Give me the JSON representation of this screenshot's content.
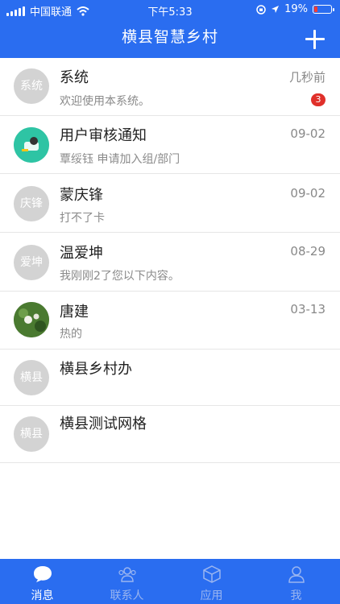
{
  "status_bar": {
    "carrier": "中国联通",
    "time": "下午5:33",
    "battery": "19%"
  },
  "header": {
    "title": "横县智慧乡村"
  },
  "messages": [
    {
      "avatar_text": "系统",
      "title": "系统",
      "time": "几秒前",
      "subtitle": "欢迎使用本系统。",
      "badge": "3"
    },
    {
      "avatar_text": "",
      "title": "用户审核通知",
      "time": "09-02",
      "subtitle": "覃绥钰 申请加入组/部门"
    },
    {
      "avatar_text": "庆锋",
      "title": "蒙庆锋",
      "time": "09-02",
      "subtitle": "打不了卡"
    },
    {
      "avatar_text": "爱坤",
      "title": "温爱坤",
      "time": "08-29",
      "subtitle": "我刚刚2了您以下内容。"
    },
    {
      "avatar_text": "",
      "title": "唐建",
      "time": "03-13",
      "subtitle": "热的"
    },
    {
      "avatar_text": "横县",
      "title": "横县乡村办"
    },
    {
      "avatar_text": "横县",
      "title": "横县测试网格"
    }
  ],
  "tabbar": {
    "tabs": [
      {
        "label": "消息",
        "icon": "chat-bubble-icon",
        "active": true
      },
      {
        "label": "联系人",
        "icon": "contacts-icon",
        "active": false
      },
      {
        "label": "应用",
        "icon": "cube-icon",
        "active": false
      },
      {
        "label": "我",
        "icon": "person-icon",
        "active": false
      }
    ]
  },
  "colors": {
    "primary": "#2a6df0",
    "badge": "#e0302a",
    "avatar_gray": "#d3d3d3"
  }
}
